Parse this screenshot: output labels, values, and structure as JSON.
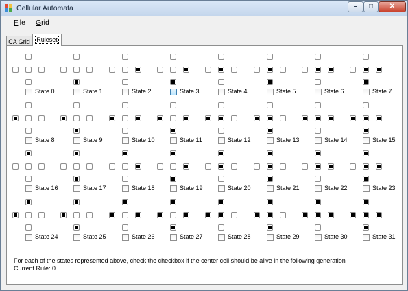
{
  "window": {
    "title": "Cellular Automata",
    "minimize_glyph": "–",
    "maximize_glyph": "□",
    "close_glyph": "✕"
  },
  "icons": {
    "app": "app-icon"
  },
  "menu": [
    {
      "accel": "F",
      "rest": "ile"
    },
    {
      "accel": "G",
      "rest": "rid"
    }
  ],
  "tabs": [
    {
      "label": "CA Grid",
      "selected": false
    },
    {
      "label": "Ruleset",
      "selected": true
    }
  ],
  "states": [
    {
      "label": "State 0",
      "checked": false
    },
    {
      "label": "State 1",
      "checked": false
    },
    {
      "label": "State 2",
      "checked": false
    },
    {
      "label": "State 3",
      "checked": false,
      "hovered": true
    },
    {
      "label": "State 4",
      "checked": false
    },
    {
      "label": "State 5",
      "checked": false
    },
    {
      "label": "State 6",
      "checked": false
    },
    {
      "label": "State 7",
      "checked": false
    },
    {
      "label": "State 8",
      "checked": false
    },
    {
      "label": "State 9",
      "checked": false
    },
    {
      "label": "State 10",
      "checked": false
    },
    {
      "label": "State 11",
      "checked": false
    },
    {
      "label": "State 12",
      "checked": false
    },
    {
      "label": "State 13",
      "checked": false
    },
    {
      "label": "State 14",
      "checked": false
    },
    {
      "label": "State 15",
      "checked": false
    },
    {
      "label": "State 16",
      "checked": false
    },
    {
      "label": "State 17",
      "checked": false
    },
    {
      "label": "State 18",
      "checked": false
    },
    {
      "label": "State 19",
      "checked": false
    },
    {
      "label": "State 20",
      "checked": false
    },
    {
      "label": "State 21",
      "checked": false
    },
    {
      "label": "State 22",
      "checked": false
    },
    {
      "label": "State 23",
      "checked": false
    },
    {
      "label": "State 24",
      "checked": false
    },
    {
      "label": "State 25",
      "checked": false
    },
    {
      "label": "State 26",
      "checked": false
    },
    {
      "label": "State 27",
      "checked": false
    },
    {
      "label": "State 28",
      "checked": false
    },
    {
      "label": "State 29",
      "checked": false
    },
    {
      "label": "State 30",
      "checked": false
    },
    {
      "label": "State 31",
      "checked": false
    }
  ],
  "instructions": "For each of the states represented above, check the checkbox if the center cell should be alive in the following generation",
  "current_rule": "Current Rule: 0"
}
